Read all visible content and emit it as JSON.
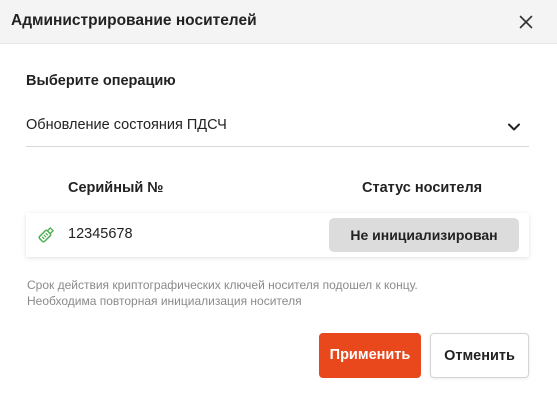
{
  "dialog": {
    "title": "Администрирование носителей",
    "close_icon": "close-icon"
  },
  "operation": {
    "label": "Выберите операцию",
    "selected": "Обновление состояния ПДСЧ",
    "dropdown_icon": "chevron-down-icon"
  },
  "table": {
    "headers": {
      "serial": "Серийный №",
      "status": "Статус носителя"
    },
    "rows": [
      {
        "icon": "usb-token-icon",
        "serial": "12345678",
        "status": "Не инициализирован"
      }
    ]
  },
  "hint": {
    "line1": "Срок действия криптографических ключей носителя подошел к концу.",
    "line2": "Необходима повторная инициализация носителя"
  },
  "buttons": {
    "apply": "Применить",
    "cancel": "Отменить"
  },
  "colors": {
    "accent": "#e8481c",
    "token_icon": "#4caf50",
    "status_badge_bg": "#dcdcdc",
    "header_bg": "#f4f4f4"
  }
}
